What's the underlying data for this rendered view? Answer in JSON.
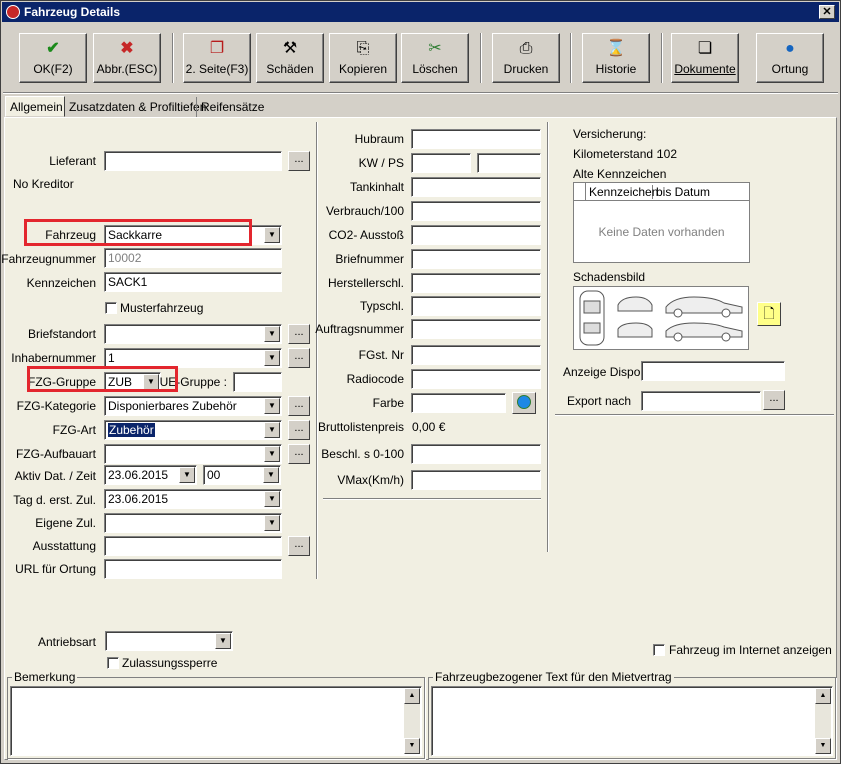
{
  "window": {
    "title": "Fahrzeug Details",
    "close_label": "✕"
  },
  "toolbar": {
    "ok": "OK(F2)",
    "cancel": "Abbr.(ESC)",
    "page2": "2. Seite(F3)",
    "damages": "Schäden",
    "copy": "Kopieren",
    "delete": "Löschen",
    "print": "Drucken",
    "history": "Historie",
    "documents": "Dokumente",
    "location": "Ortung"
  },
  "tabs": [
    "Allgemein",
    "Zusatzdaten & Profiltiefen",
    "Reifensätze"
  ],
  "left": {
    "lieferant_label": "Lieferant",
    "lieferant_value": "",
    "no_kreditor": "No Kreditor",
    "fahrzeug_label": "Fahrzeug",
    "fahrzeug_value": "Sackkarre",
    "fahrzeugnummer_label": "Fahrzeugnummer",
    "fahrzeugnummer_value": "10002",
    "kennzeichen_label": "Kennzeichen",
    "kennzeichen_value": "SACK1",
    "musterfahrzeug_label": "Musterfahrzeug",
    "briefstandort_label": "Briefstandort",
    "inhabernummer_label": "Inhabernummer",
    "inhabernummer_value": "1",
    "fzg_gruppe_label": "FZG-Gruppe",
    "fzg_gruppe_value": "ZUB",
    "ue_gruppe_label": "UE-Gruppe :",
    "fzg_kategorie_label": "FZG-Kategorie",
    "fzg_kategorie_value": "Disponierbares Zubehör",
    "fzg_art_label": "FZG-Art",
    "fzg_art_value": "Zubehör",
    "fzg_aufbauart_label": "FZG-Aufbauart",
    "aktiv_label": "Aktiv Dat. / Zeit",
    "aktiv_date": "23.06.2015",
    "aktiv_time": "00",
    "tag_label": "Tag d. erst. Zul.",
    "tag_value": "23.06.2015",
    "eigene_zul_label": "Eigene Zul.",
    "ausstattung_label": "Ausstattung",
    "url_label": "URL für Ortung",
    "antriebsart_label": "Antriebsart",
    "zulassungssperre_label": "Zulassungssperre",
    "dots": "..."
  },
  "middle": {
    "hubraum": "Hubraum",
    "kw_ps": "KW / PS",
    "tankinhalt": "Tankinhalt",
    "verbrauch": "Verbrauch/100",
    "co2": "CO2- Ausstoß",
    "briefnummer": "Briefnummer",
    "herstellerschl": "Herstellerschl.",
    "typschl": "Typschl.",
    "auftragsnummer": "Auftragsnummer",
    "fgst_nr": "FGst. Nr",
    "radiocode": "Radiocode",
    "farbe": "Farbe",
    "bruttolistenpreis_label": "Bruttolistenpreis",
    "bruttolistenpreis_value": "0,00 €",
    "beschl": "Beschl. s 0-100",
    "vmax": "VMax(Km/h)"
  },
  "right": {
    "versicherung": "Versicherung:",
    "kilometerstand_label": "Kilometerstand :",
    "kilometerstand_value": "102",
    "alte_kennzeichen": "Alte Kennzeichen",
    "col_kennzeichen": "Kennzeichen",
    "col_bis_datum": "bis Datum",
    "keine_daten": "Keine Daten vorhanden",
    "schadensbild": "Schadensbild",
    "anzeige_dispo": "Anzeige Dispo",
    "export_nach": "Export nach",
    "internet_label": "Fahrzeug im Internet anzeigen"
  },
  "bottom": {
    "bemerkung": "Bemerkung",
    "mietvertrag_text": "Fahrzeugbezogener Text für den Mietvertrag"
  }
}
